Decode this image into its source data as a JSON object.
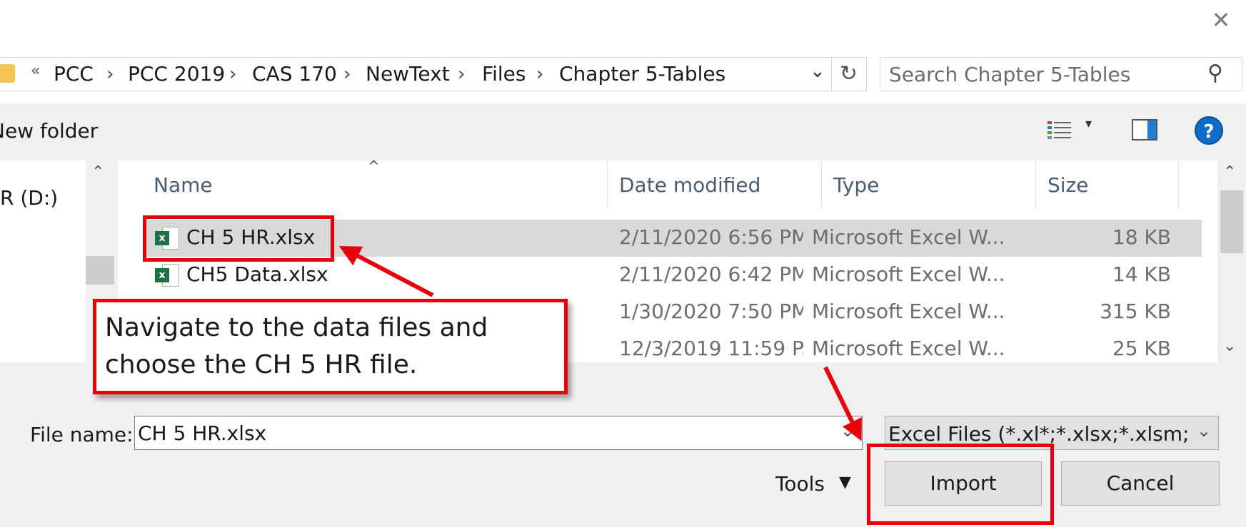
{
  "window": {
    "close_glyph": "✕"
  },
  "address_bar": {
    "overflow_glyph": "«",
    "breadcrumbs": [
      "PCC",
      "PCC 2019",
      "CAS 170",
      "NewText",
      "Files",
      "Chapter 5-Tables"
    ],
    "separator_glyph": "›",
    "dropdown_glyph": "⌄",
    "refresh_glyph": "↻"
  },
  "search": {
    "placeholder": "Search Chapter 5-Tables",
    "icon_glyph": "⚲"
  },
  "toolbar": {
    "new_folder_label": "New folder",
    "help_label": "?",
    "view_dropdown_glyph": "▾"
  },
  "nav_pane": {
    "items": [
      "R (D:)"
    ],
    "scroll_up_glyph": "⌃"
  },
  "file_list": {
    "sort_glyph": "^",
    "columns": {
      "name": "Name",
      "date": "Date modified",
      "type": "Type",
      "size": "Size"
    },
    "rows": [
      {
        "name": "CH 5 HR.xlsx",
        "date": "2/11/2020 6:56 PM",
        "type": "Microsoft Excel W...",
        "size": "18 KB",
        "selected": true
      },
      {
        "name": "CH5 Data.xlsx",
        "date": "2/11/2020 6:42 PM",
        "type": "Microsoft Excel W...",
        "size": "14 KB",
        "selected": false
      },
      {
        "name": "",
        "date": "1/30/2020 7:50 PM",
        "type": "Microsoft Excel W...",
        "size": "315 KB",
        "selected": false
      },
      {
        "name": "",
        "date": "12/3/2019 11:59 P...",
        "type": "Microsoft Excel W...",
        "size": "25 KB",
        "selected": false
      }
    ],
    "excel_badge": "x",
    "scroll_up_glyph": "⌃",
    "scroll_down_glyph": "⌄"
  },
  "bottom": {
    "file_name_label": "File name:",
    "file_name_value": "CH 5 HR.xlsx",
    "file_name_dropdown_glyph": "⌄",
    "file_type_value": "Excel Files (*.xl*;*.xlsx;*.xlsm;*.xls",
    "file_type_dropdown_glyph": "⌄",
    "tools_label": "Tools",
    "tools_caret": "▼",
    "import_label": "Import",
    "cancel_label": "Cancel"
  },
  "annotation": {
    "callout_text": "Navigate to the data files and choose the CH 5 HR file.",
    "color": "#e8000b"
  }
}
